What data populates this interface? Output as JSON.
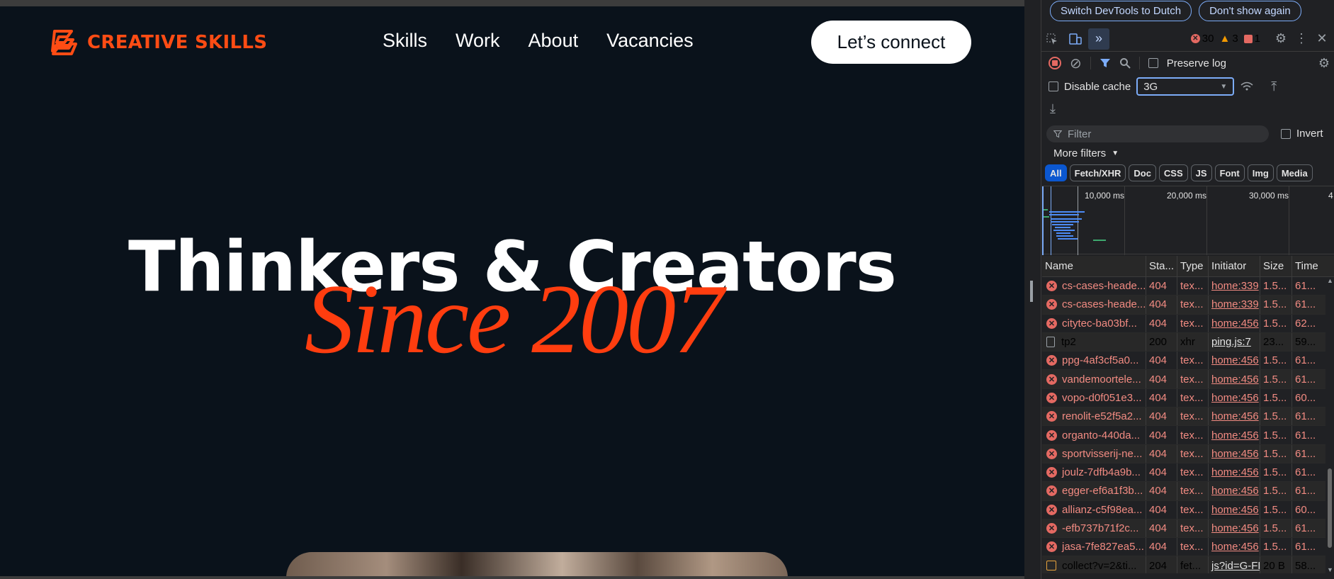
{
  "site": {
    "logo_text": "CREATIVE SKILLS",
    "nav": [
      "Skills",
      "Work",
      "About",
      "Vacancies"
    ],
    "cta": "Let’s connect",
    "hero_title": "Thinkers & Creators",
    "hero_since": "Since 2007",
    "colors": {
      "background": "#0a121b",
      "accent": "#ff4c14",
      "text": "#ffffff"
    }
  },
  "devtools": {
    "infobar": {
      "switch_language": "Switch DevTools to Dutch",
      "dont_show": "Don't show again"
    },
    "counts": {
      "errors": "30",
      "warnings": "3",
      "issues": "1"
    },
    "toolbar": {
      "preserve_log": "Preserve log",
      "disable_cache": "Disable cache",
      "throttle": "3G"
    },
    "filter": {
      "placeholder": "Filter",
      "invert": "Invert",
      "more_filters": "More filters"
    },
    "type_filters": [
      "All",
      "Fetch/XHR",
      "Doc",
      "CSS",
      "JS",
      "Font",
      "Img",
      "Media"
    ],
    "timeline_labels": [
      "10,000 ms",
      "20,000 ms",
      "30,000 ms",
      "4"
    ],
    "columns": [
      "Name",
      "Sta...",
      "Type",
      "Initiator",
      "Size",
      "Time"
    ],
    "rows": [
      {
        "icon": "error",
        "name": "cs-cases-heade...",
        "status": "404",
        "type": "tex...",
        "initiator": "home:339",
        "size": "1.5...",
        "time": "61..."
      },
      {
        "icon": "error",
        "name": "cs-cases-heade...",
        "status": "404",
        "type": "tex...",
        "initiator": "home:339",
        "size": "1.5...",
        "time": "61..."
      },
      {
        "icon": "error",
        "name": "citytec-ba03bf...",
        "status": "404",
        "type": "tex...",
        "initiator": "home:456",
        "size": "1.5...",
        "time": "62..."
      },
      {
        "icon": "doc",
        "name": "tp2",
        "status": "200",
        "type": "xhr",
        "initiator": "ping.js:7",
        "size": "23...",
        "time": "59..."
      },
      {
        "icon": "error",
        "name": "ppg-4af3cf5a0...",
        "status": "404",
        "type": "tex...",
        "initiator": "home:456",
        "size": "1.5...",
        "time": "61..."
      },
      {
        "icon": "error",
        "name": "vandemoortele...",
        "status": "404",
        "type": "tex...",
        "initiator": "home:456",
        "size": "1.5...",
        "time": "61..."
      },
      {
        "icon": "error",
        "name": "vopo-d0f051e3...",
        "status": "404",
        "type": "tex...",
        "initiator": "home:456",
        "size": "1.5...",
        "time": "60..."
      },
      {
        "icon": "error",
        "name": "renolit-e52f5a2...",
        "status": "404",
        "type": "tex...",
        "initiator": "home:456",
        "size": "1.5...",
        "time": "61..."
      },
      {
        "icon": "error",
        "name": "organto-440da...",
        "status": "404",
        "type": "tex...",
        "initiator": "home:456",
        "size": "1.5...",
        "time": "61..."
      },
      {
        "icon": "error",
        "name": "sportvisserij-ne...",
        "status": "404",
        "type": "tex...",
        "initiator": "home:456",
        "size": "1.5...",
        "time": "61..."
      },
      {
        "icon": "error",
        "name": "joulz-7dfb4a9b...",
        "status": "404",
        "type": "tex...",
        "initiator": "home:456",
        "size": "1.5...",
        "time": "61..."
      },
      {
        "icon": "error",
        "name": "egger-ef6a1f3b...",
        "status": "404",
        "type": "tex...",
        "initiator": "home:456",
        "size": "1.5...",
        "time": "61..."
      },
      {
        "icon": "error",
        "name": "allianz-c5f98ea...",
        "status": "404",
        "type": "tex...",
        "initiator": "home:456",
        "size": "1.5...",
        "time": "60..."
      },
      {
        "icon": "error",
        "name": "-efb737b71f2c...",
        "status": "404",
        "type": "tex...",
        "initiator": "home:456",
        "size": "1.5...",
        "time": "61..."
      },
      {
        "icon": "error",
        "name": "jasa-7fe827ea5...",
        "status": "404",
        "type": "tex...",
        "initiator": "home:456",
        "size": "1.5...",
        "time": "61..."
      },
      {
        "icon": "xhr",
        "name": "collect?v=2&ti...",
        "status": "204",
        "type": "fet...",
        "initiator": "js?id=G-FL",
        "size": "20 B",
        "time": "58..."
      }
    ]
  }
}
